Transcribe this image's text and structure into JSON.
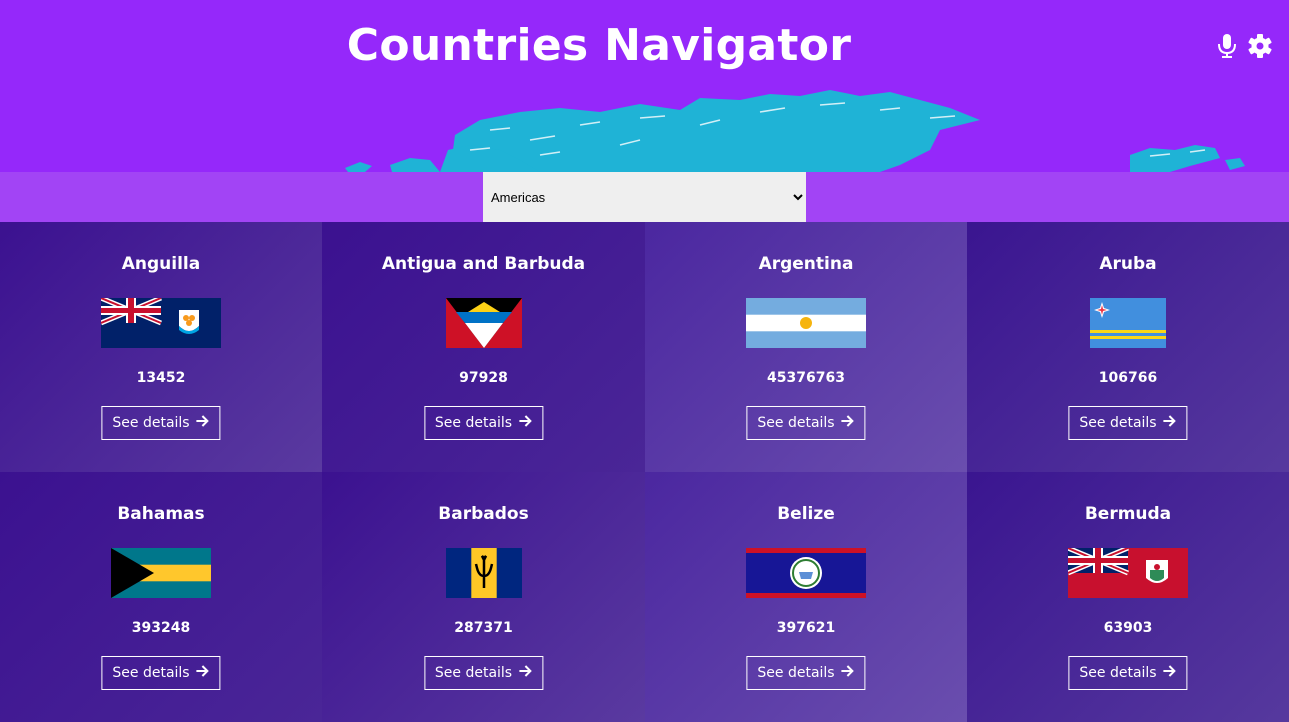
{
  "header": {
    "title": "Countries Navigator",
    "icons": [
      "microphone-icon",
      "gear-icon"
    ]
  },
  "filter": {
    "selected": "Americas",
    "options": [
      "Americas"
    ]
  },
  "countries": [
    {
      "name": "Anguilla",
      "population": "13452",
      "button": "See details",
      "flag": "anguilla"
    },
    {
      "name": "Antigua and Barbuda",
      "population": "97928",
      "button": "See details",
      "flag": "antigua"
    },
    {
      "name": "Argentina",
      "population": "45376763",
      "button": "See details",
      "flag": "argentina"
    },
    {
      "name": "Aruba",
      "population": "106766",
      "button": "See details",
      "flag": "aruba"
    },
    {
      "name": "Bahamas",
      "population": "393248",
      "button": "See details",
      "flag": "bahamas"
    },
    {
      "name": "Barbados",
      "population": "287371",
      "button": "See details",
      "flag": "barbados"
    },
    {
      "name": "Belize",
      "population": "397621",
      "button": "See details",
      "flag": "belize"
    },
    {
      "name": "Bermuda",
      "population": "63903",
      "button": "See details",
      "flag": "bermuda"
    }
  ],
  "colors": {
    "header": "#9528fa",
    "filter_bar": "#a244f5",
    "map": "#1fb3d6",
    "text": "#ffffff"
  }
}
